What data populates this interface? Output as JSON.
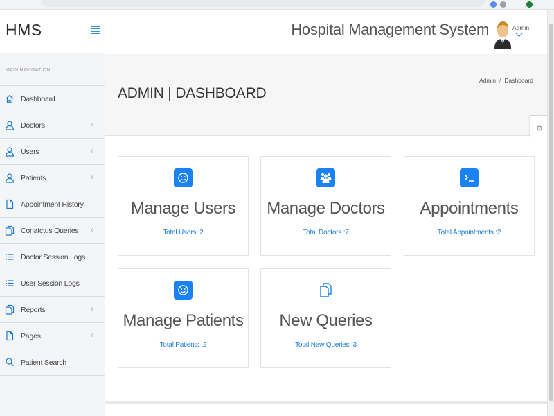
{
  "sidebar": {
    "brand": "HMS",
    "nav_heading": "MAIN NAVIGATION",
    "items": [
      {
        "label": "Dashboard",
        "icon": "home-icon",
        "has_submenu": false
      },
      {
        "label": "Doctors",
        "icon": "user-icon",
        "has_submenu": true
      },
      {
        "label": "Users",
        "icon": "user-icon",
        "has_submenu": true
      },
      {
        "label": "Patients",
        "icon": "user-icon",
        "has_submenu": true
      },
      {
        "label": "Appointment History",
        "icon": "file-icon",
        "has_submenu": false
      },
      {
        "label": "Conatctus Queries",
        "icon": "files-icon",
        "has_submenu": true
      },
      {
        "label": "Doctor Session Logs",
        "icon": "list-icon",
        "has_submenu": false
      },
      {
        "label": "User Session Logs",
        "icon": "list-icon",
        "has_submenu": false
      },
      {
        "label": "Reports",
        "icon": "files-icon",
        "has_submenu": true
      },
      {
        "label": "Pages",
        "icon": "file-icon",
        "has_submenu": true
      },
      {
        "label": "Patient Search",
        "icon": "search-icon",
        "has_submenu": false
      }
    ]
  },
  "header": {
    "title": "Hospital Management System",
    "user_name": "Admin"
  },
  "page": {
    "title": "ADMIN | DASHBOARD",
    "breadcrumb": [
      "Admin",
      "Dashboard"
    ]
  },
  "cards": [
    {
      "title": "Manage Users",
      "link": "Total Users :2",
      "icon": "smile-icon"
    },
    {
      "title": "Manage Doctors",
      "link": "Total Doctors :7",
      "icon": "users-icon"
    },
    {
      "title": "Appointments",
      "link": "Total Appointments :2",
      "icon": "terminal-icon"
    },
    {
      "title": "Manage Patients",
      "link": "Total Patients :2",
      "icon": "smile-icon"
    },
    {
      "title": "New Queries",
      "link": "Total New Queries :3",
      "icon": "files-icon"
    }
  ],
  "colors": {
    "accent": "#1a82f4",
    "link": "#1a7cd6",
    "sidebar_icon": "#1a7cd6",
    "sidebar_bg": "#f4f5f7",
    "title_band_bg": "#f6f6f6"
  }
}
